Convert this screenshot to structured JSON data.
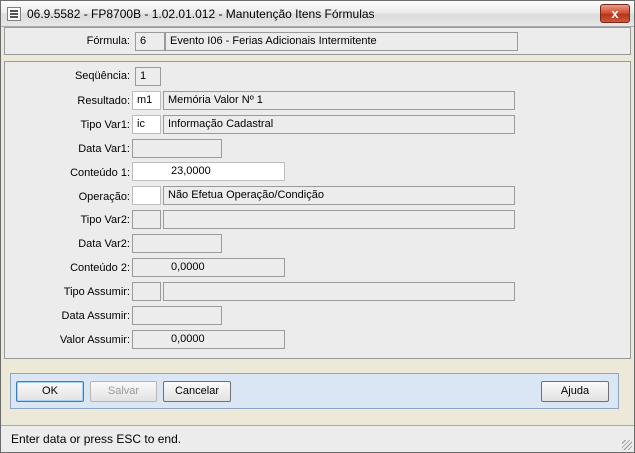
{
  "window": {
    "title": "06.9.5582 - FP8700B - 1.02.01.012 - Manutenção Itens Fórmulas",
    "close_label": "x"
  },
  "header": {
    "formula_label": "Fórmula:",
    "formula_code": "6",
    "formula_desc": "Evento I06 - Ferias Adicionais Intermitente"
  },
  "form": {
    "sequencia_label": "Seqüência:",
    "sequencia_value": "1",
    "resultado_label": "Resultado:",
    "resultado_code": "m1",
    "resultado_desc": "Memória Valor Nº 1",
    "tipovar1_label": "Tipo Var1:",
    "tipovar1_code": "ic",
    "tipovar1_desc": "Informação Cadastral",
    "datavar1_label": "Data Var1:",
    "datavar1_value": "",
    "conteudo1_label": "Conteúdo 1:",
    "conteudo1_value": "23,0000",
    "operacao_label": "Operação:",
    "operacao_code": "",
    "operacao_desc": "Não Efetua Operação/Condição",
    "tipovar2_label": "Tipo Var2:",
    "tipovar2_code": "",
    "tipovar2_desc": "",
    "datavar2_label": "Data Var2:",
    "datavar2_value": "",
    "conteudo2_label": "Conteúdo 2:",
    "conteudo2_value": "0,0000",
    "tipoassumir_label": "Tipo Assumir:",
    "tipoassumir_code": "",
    "tipoassumir_desc": "",
    "dataassumir_label": "Data Assumir:",
    "dataassumir_value": "",
    "valorassumir_label": "Valor Assumir:",
    "valorassumir_value": "0,0000"
  },
  "buttons": {
    "ok_label": "OK",
    "salvar_label": "Salvar",
    "cancelar_label": "Cancelar",
    "ajuda_label": "Ajuda"
  },
  "status": {
    "text": "Enter data or press ESC to end."
  }
}
